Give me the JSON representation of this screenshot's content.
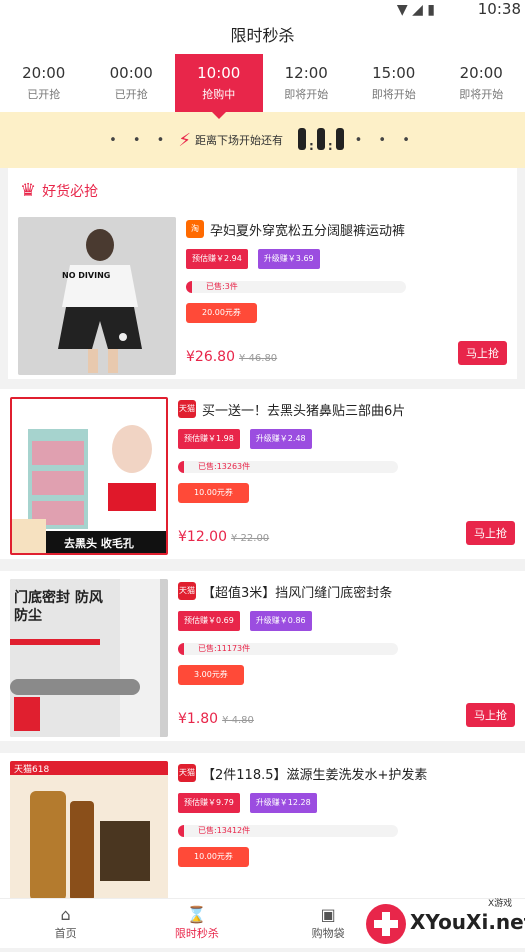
{
  "status": {
    "time": "10:38"
  },
  "header": {
    "title": "限时秒杀"
  },
  "tabs": [
    {
      "time": "20:00",
      "status": "已开抢"
    },
    {
      "time": "00:00",
      "status": "已开抢"
    },
    {
      "time": "10:00",
      "status": "抢购中"
    },
    {
      "time": "12:00",
      "status": "即将开始"
    },
    {
      "time": "15:00",
      "status": "即将开始"
    },
    {
      "time": "20:00",
      "status": "即将开始"
    }
  ],
  "countdown": {
    "label": "距离下场开始还有"
  },
  "section": {
    "title": "好货必抢"
  },
  "products": [
    {
      "platform": "淘",
      "title": "孕妇夏外穿宽松五分阔腿裤运动裤",
      "earn_pre": "预估赚￥2.94",
      "earn_up": "升级赚￥3.69",
      "sold": "已售:3件",
      "coupon": "20.00元券",
      "price": "¥26.80",
      "original": "¥ 46.80",
      "buy": "马上抢",
      "img_caption": "NO DIVING"
    },
    {
      "platform": "天猫",
      "title": "买一送一！去黑头猪鼻贴三部曲6片",
      "earn_pre": "预估赚￥1.98",
      "earn_up": "升级赚￥2.48",
      "sold": "已售:13263件",
      "coupon": "10.00元券",
      "price": "¥12.00",
      "original": "¥ 22.00",
      "buy": "马上抢",
      "img_caption": "去黑头 收毛孔"
    },
    {
      "platform": "天猫",
      "title": "【超值3米】挡风门缝门底密封条",
      "earn_pre": "预估赚￥0.69",
      "earn_up": "升级赚￥0.86",
      "sold": "已售:11173件",
      "coupon": "3.00元券",
      "price": "¥1.80",
      "original": "¥ 4.80",
      "buy": "马上抢",
      "img_caption": "门底密封 防风防尘"
    },
    {
      "platform": "天猫",
      "title": "【2件118.5】滋源生姜洗发水+护发素",
      "earn_pre": "预估赚￥9.79",
      "earn_up": "升级赚￥12.28",
      "sold": "已售:13412件",
      "coupon": "10.00元券",
      "price": "",
      "original": "",
      "buy": "",
      "img_caption": "天猫618"
    }
  ],
  "nav": [
    {
      "label": "首页"
    },
    {
      "label": "限时秒杀"
    },
    {
      "label": "购物袋"
    }
  ],
  "watermark": {
    "text": "XYouXi.net",
    "sub": "X游戏"
  }
}
